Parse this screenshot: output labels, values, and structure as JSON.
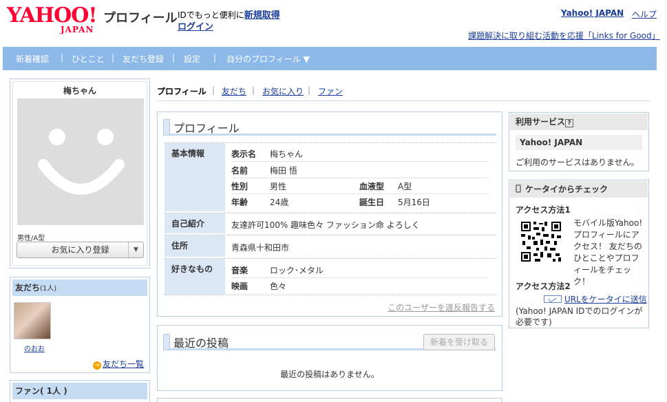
{
  "header": {
    "logo_text": "YAHOO!",
    "logo_sub": "JAPAN",
    "title": "プロフィール",
    "id_promo_prefix": "IDでもっと便利に",
    "signup_label": "新規取得",
    "login_label": "ログイン",
    "yahoo_japan_link": "Yahoo! JAPAN",
    "help_link": "ヘルプ",
    "links_for_good": "課題解決に取り組む活動を応援「Links for Good」"
  },
  "nav": {
    "items": [
      "新着確認",
      "ひとこと",
      "友だち登録",
      "設定",
      "自分のプロフィール ▼"
    ],
    "separator": "|"
  },
  "profile_card": {
    "name": "梅ちゃん",
    "gender_blood": "男性/A型",
    "favorite_button": "お気に入り登録",
    "dropdown_glyph": "▼"
  },
  "friends_box": {
    "title": "友だち",
    "count": "(1人)",
    "friend_name": "のおお",
    "view_all": "友だち一覧",
    "arrow_glyph": "→"
  },
  "fans_box": {
    "title": "ファン( 1人 )"
  },
  "tabs": {
    "active": "プロフィール",
    "items": [
      "友だち",
      "お気に入り",
      "ファン"
    ],
    "separator": "|"
  },
  "profile_panel": {
    "title": "プロフィール",
    "basic_label": "基本情報",
    "display_name_key": "表示名",
    "display_name_val": "梅ちゃん",
    "name_key": "名前",
    "name_val": "梅田 悟",
    "gender_key": "性別",
    "gender_val": "男性",
    "blood_key": "血液型",
    "blood_val": "A型",
    "age_key": "年齢",
    "age_val": "24歳",
    "birthday_key": "誕生日",
    "birthday_val": "5月16日",
    "intro_label": "自己紹介",
    "intro_val": "友達許可100% 趣味色々 ファッション命 よろしく",
    "address_label": "住所",
    "address_val": "青森県十和田市",
    "likes_label": "好きなもの",
    "music_key": "音楽",
    "music_val": "ロック･メタル",
    "movie_key": "映画",
    "movie_val": "色々",
    "report_link": "このユーザーを違反報告する"
  },
  "posts_panel": {
    "title": "最近の投稿",
    "receive_button": "新着を受け取る",
    "empty_text": "最近の投稿はありません。"
  },
  "services_box": {
    "title": "利用サービス",
    "help_glyph": "?",
    "service_name": "Yahoo! JAPAN",
    "none_text": "ご利用のサービスはありません。"
  },
  "mobile_box": {
    "title": "ケータイからチェック",
    "access1": "アクセス方法1",
    "qr_desc": "モバイル版Yahoo!プロフィールにアクセス！ 友だちのひとことやプロフィールをチェック！",
    "access2": "アクセス方法2",
    "send_url": "URLをケータイに送信",
    "note": "(Yahoo! JAPAN IDでのログインが必要です)"
  },
  "colors": {
    "nav_bg": "#8db9e8",
    "accent_red": "#ff0033",
    "link": "#1a3d9b",
    "box_border": "#b7cde6",
    "label_bg": "#dbe7f5"
  }
}
